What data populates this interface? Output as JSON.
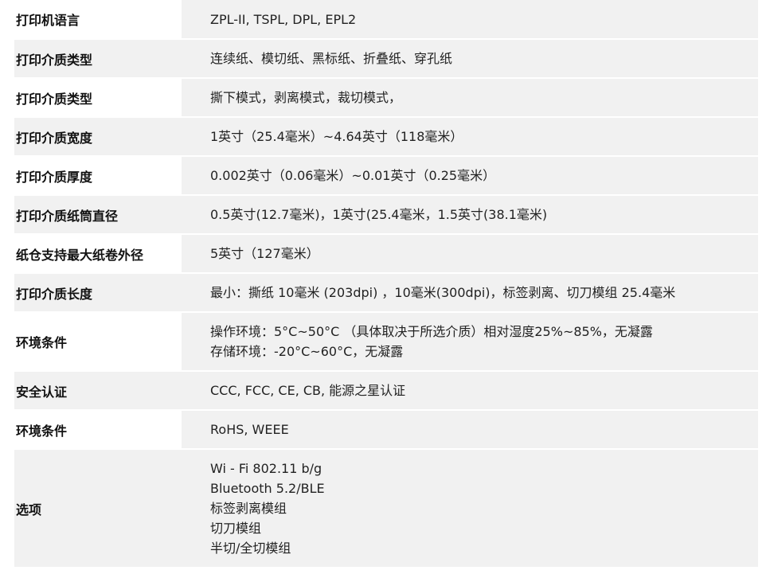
{
  "rows": [
    {
      "label": "打印机语言",
      "lines": [
        "ZPL-II, TSPL, DPL, EPL2"
      ]
    },
    {
      "label": "打印介质类型",
      "lines": [
        "连续纸、模切纸、黑标纸、折叠纸、穿孔纸"
      ]
    },
    {
      "label": "打印介质类型",
      "lines": [
        "撕下模式，剥离模式，裁切模式，"
      ]
    },
    {
      "label": "打印介质宽度",
      "lines": [
        "1英寸（25.4毫米）~4.64英寸（118毫米）"
      ]
    },
    {
      "label": "打印介质厚度",
      "lines": [
        "0.002英寸（0.06毫米）~0.01英寸（0.25毫米）"
      ]
    },
    {
      "label": "打印介质纸筒直径",
      "lines": [
        "0.5英寸(12.7毫米)，1英寸(25.4毫米，1.5英寸(38.1毫米)"
      ]
    },
    {
      "label": "纸仓支持最大纸卷外径",
      "lines": [
        "5英寸（127毫米）"
      ]
    },
    {
      "label": "打印介质长度",
      "lines": [
        "最小：撕纸 10毫米 (203dpi) ，10毫米(300dpi)，标签剥离、切刀模组 25.4毫米"
      ]
    },
    {
      "label": "环境条件",
      "lines": [
        "操作环境：5°C~50°C （具体取决于所选介质）相对湿度25%~85%，无凝露",
        "存储环境：-20°C~60°C，无凝露"
      ]
    },
    {
      "label": "安全认证",
      "lines": [
        "CCC, FCC, CE, CB, 能源之星认证"
      ]
    },
    {
      "label": "环境条件",
      "lines": [
        "RoHS, WEEE"
      ]
    },
    {
      "label": "选项",
      "lines": [
        "Wi - Fi 802.11 b/g",
        "Bluetooth 5.2/BLE",
        "标签剥离模组",
        "切刀模组",
        "半切/全切模组"
      ]
    }
  ]
}
